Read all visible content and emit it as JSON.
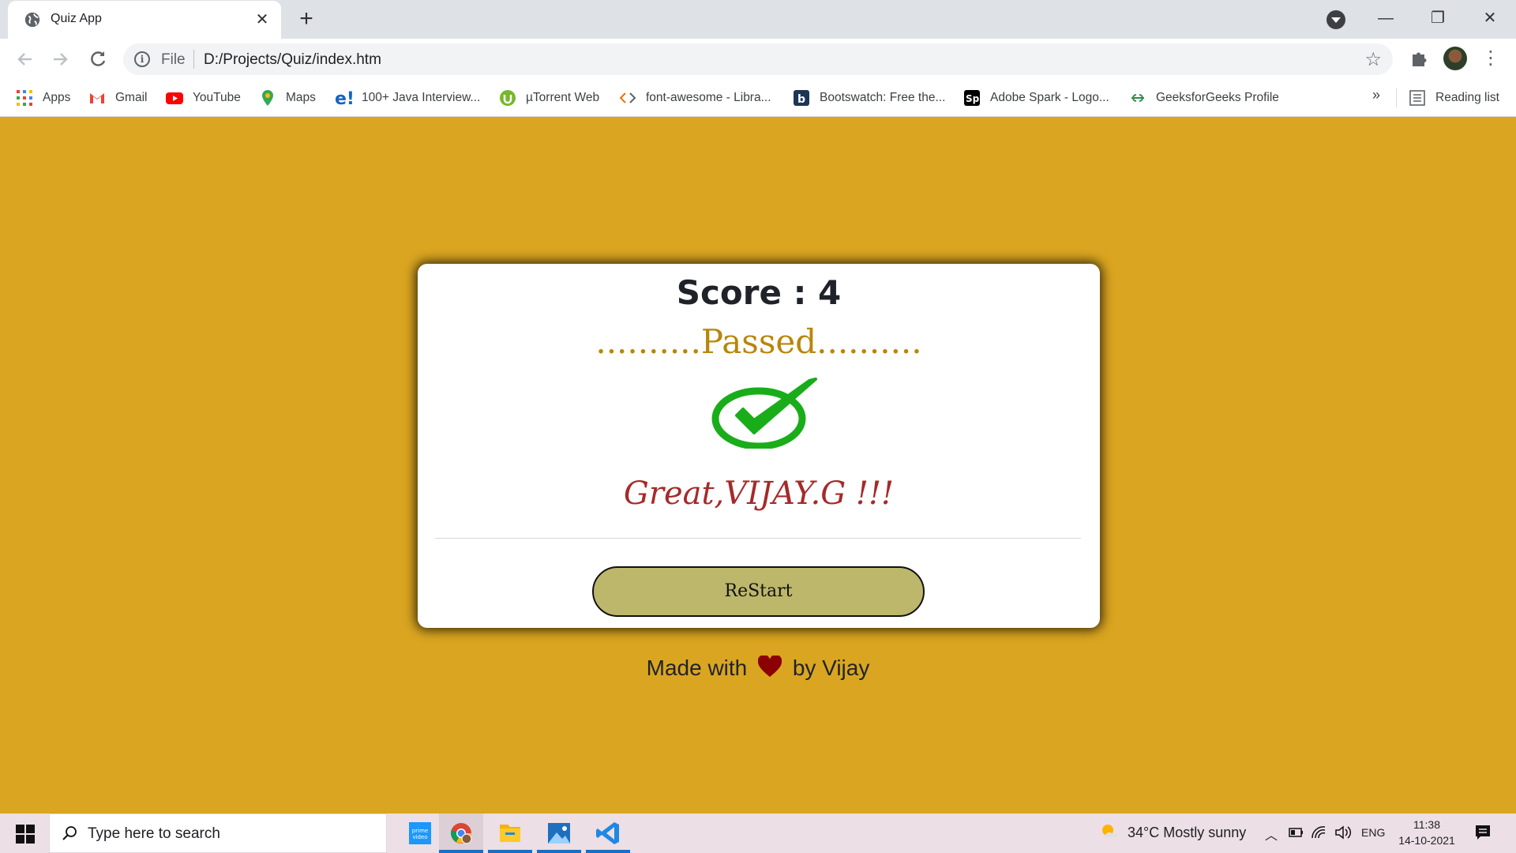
{
  "browser": {
    "tab_title": "Quiz App",
    "tab_close": "✕",
    "new_tab": "+",
    "address_scheme": "File",
    "address_url": "D:/Projects/Quiz/index.htm",
    "window_controls": {
      "minimize": "—",
      "restore": "❐",
      "close": "✕"
    }
  },
  "bookmarks": {
    "items": [
      {
        "label": "Apps",
        "icon": "apps-grid-icon"
      },
      {
        "label": "Gmail",
        "icon": "gmail-icon"
      },
      {
        "label": "YouTube",
        "icon": "youtube-icon"
      },
      {
        "label": "Maps",
        "icon": "maps-icon"
      },
      {
        "label": "100+ Java Interview...",
        "icon": "e-icon"
      },
      {
        "label": "µTorrent Web",
        "icon": "utorrent-icon"
      },
      {
        "label": "font-awesome - Libra...",
        "icon": "code-icon"
      },
      {
        "label": "Bootswatch: Free the...",
        "icon": "bootswatch-icon"
      },
      {
        "label": "Adobe Spark - Logo...",
        "icon": "adobe-spark-icon"
      },
      {
        "label": "GeeksforGeeks Profile",
        "icon": "geeksforgeeks-icon"
      }
    ],
    "more": "»",
    "reading_list": "Reading list"
  },
  "quiz": {
    "score_label": "Score : 4",
    "result_text": "..........Passed..........",
    "greeting": "Great,VIJAY.G !!!",
    "restart_button": "ReStart",
    "colors": {
      "background": "#daa520",
      "result": "#b8860b",
      "greeting": "#a52a2a",
      "button": "#bdb76b",
      "check": "#1aad1a"
    }
  },
  "footer": {
    "made_with": "Made with",
    "by": "by Vijay"
  },
  "taskbar": {
    "search_placeholder": "Type here to search",
    "weather": "34°C  Mostly sunny",
    "language": "ENG",
    "time": "11:38",
    "date": "14-10-2021"
  }
}
